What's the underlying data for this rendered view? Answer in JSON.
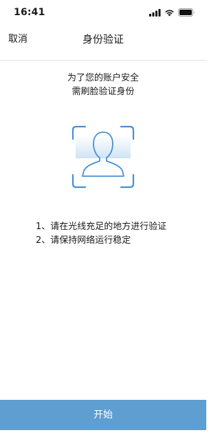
{
  "status_bar": {
    "time": "16:41",
    "icons": [
      "signal-icon",
      "wifi-icon",
      "battery-icon"
    ]
  },
  "nav": {
    "cancel_label": "取消",
    "title": "身份验证"
  },
  "prompt": {
    "line1": "为了您的账户安全",
    "line2": "需刷脸验证身份"
  },
  "face_icon": "face-scan-icon",
  "tips": [
    "1、请在光线充足的地方进行验证",
    "2、请保持网络运行稳定"
  ],
  "start_button": {
    "label": "开始"
  },
  "colors": {
    "accent": "#5e9ed1",
    "frame": "#4a8ed0",
    "scan_gradient": "#cfe3f5",
    "divider": "#e3e3e3"
  }
}
